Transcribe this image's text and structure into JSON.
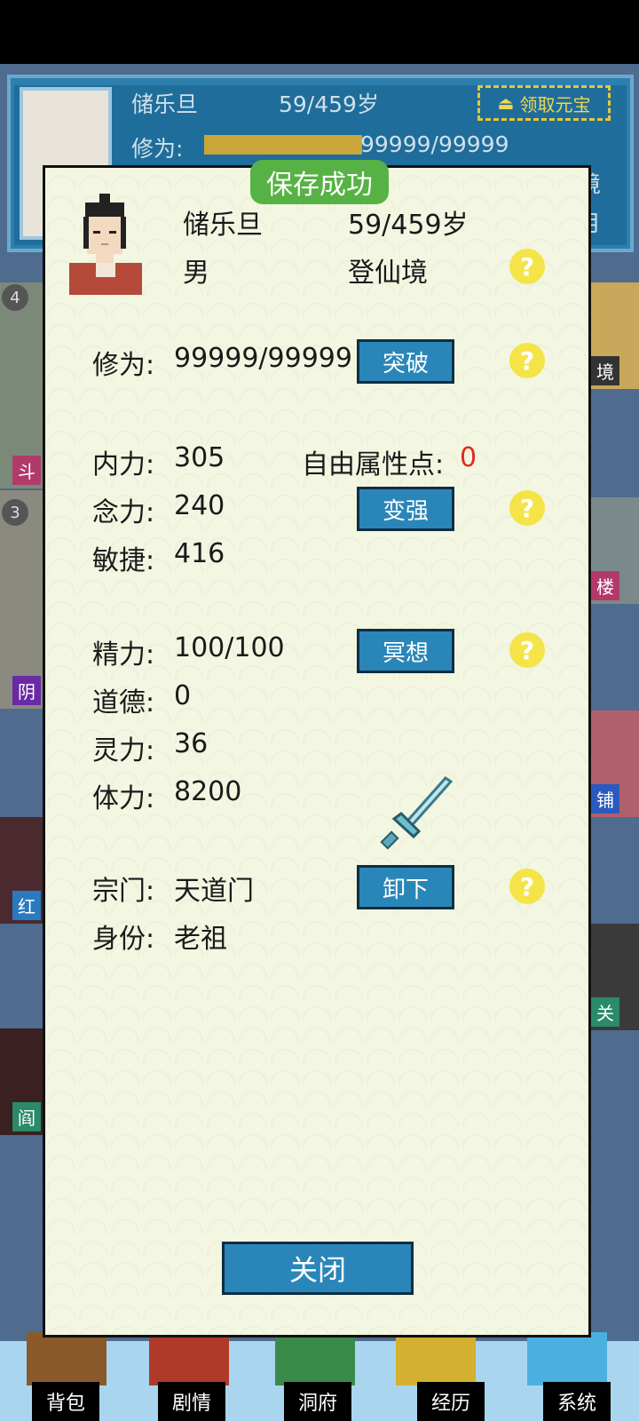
{
  "header": {
    "name": "储乐旦",
    "age": "59/459岁",
    "cultivation_label": "修为:",
    "cultivation_value": "99999/99999",
    "claim_gold_label": "领取元宝",
    "realm_tail": "境",
    "month_tail": "月"
  },
  "side_tiles": {
    "left": [
      "斗",
      "阴",
      "红",
      "阎"
    ],
    "right": [
      "楼",
      "铺",
      "关"
    ],
    "badges": [
      "4",
      "3"
    ],
    "right_top": "境"
  },
  "toast": "保存成功",
  "profile": {
    "name": "储乐旦",
    "age": "59/459岁",
    "gender": "男",
    "realm": "登仙境"
  },
  "stats": {
    "cultivation_label": "修为:",
    "cultivation_value": "99999/99999",
    "breakthrough_button": "突破",
    "internal_label": "内力:",
    "internal_value": "305",
    "free_points_label": "自由属性点:",
    "free_points_value": "0",
    "mind_label": "念力:",
    "mind_value": "240",
    "strengthen_button": "变强",
    "agility_label": "敏捷:",
    "agility_value": "416",
    "energy_label": "精力:",
    "energy_value": "100/100",
    "meditate_button": "冥想",
    "morality_label": "道德:",
    "morality_value": "0",
    "spirit_label": "灵力:",
    "spirit_value": "36",
    "stamina_label": "体力:",
    "stamina_value": "8200",
    "sect_label": "宗门:",
    "sect_value": "天道门",
    "unequip_button": "卸下",
    "identity_label": "身份:",
    "identity_value": "老祖",
    "help": "?"
  },
  "close_button": "关闭",
  "nav": [
    "背包",
    "剧情",
    "洞府",
    "经历",
    "系统"
  ],
  "colors": {
    "button": "#2a86b8",
    "toast": "#56b244",
    "help": "#f5e448",
    "highlight": "#e32a20"
  }
}
